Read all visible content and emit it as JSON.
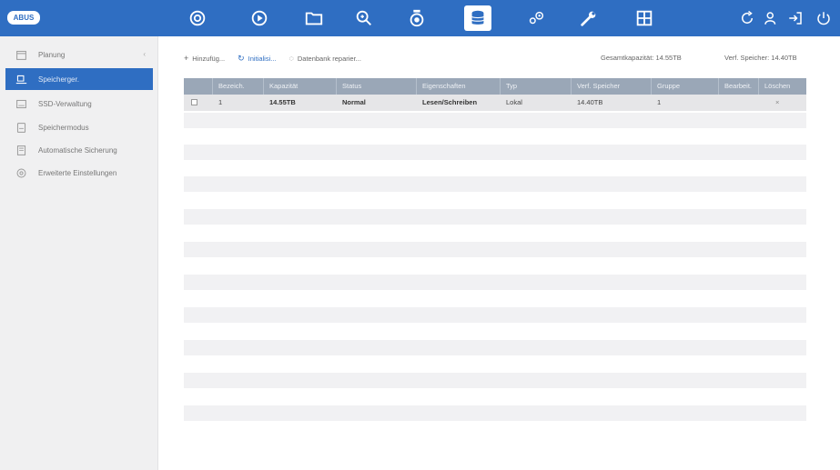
{
  "brand": {
    "label": "ABUS"
  },
  "colors": {
    "topbar": "#2f6ec2",
    "sidebar_active": "#2f6ec2",
    "table_header": "#9aa7b7",
    "row_stripe": "#f1f1f3"
  },
  "topnav": [
    {
      "icon": "camera-eye-icon"
    },
    {
      "icon": "playback-icon"
    },
    {
      "icon": "folder-icon"
    },
    {
      "icon": "search-zoom-icon"
    },
    {
      "icon": "ptz-camera-icon"
    },
    {
      "icon": "storage-database-icon",
      "active": true
    },
    {
      "icon": "settings-gears-icon"
    },
    {
      "icon": "maintenance-wrench-icon"
    },
    {
      "icon": "multiview-grid-icon"
    }
  ],
  "topright": [
    {
      "icon": "refresh-icon"
    },
    {
      "icon": "user-icon"
    },
    {
      "icon": "logout-icon"
    },
    {
      "icon": "power-icon"
    }
  ],
  "sidebar": {
    "items": [
      {
        "label": "Planung",
        "icon": "calendar-icon",
        "chevron": "‹"
      },
      {
        "label": "Speicherger.",
        "icon": "hdd-icon",
        "active": true
      },
      {
        "label": "SSD-Verwaltung",
        "icon": "ssd-icon"
      },
      {
        "label": "Speichermodus",
        "icon": "storage-mode-icon"
      },
      {
        "label": "Automatische Sicherung",
        "icon": "backup-icon"
      },
      {
        "label": "Erweiterte Einstellungen",
        "icon": "advanced-settings-icon"
      }
    ]
  },
  "toolbar": {
    "add": {
      "label": "Hinzufüg...",
      "icon": "+"
    },
    "init": {
      "label": "Initialisi...",
      "icon": "↻"
    },
    "repair": {
      "label": "Datenbank reparier...",
      "icon": "◌"
    }
  },
  "capacity": {
    "total": "Gesamtkapazität: 14.55TB",
    "free": "Verf. Speicher: 14.40TB"
  },
  "table": {
    "columns": [
      "Bezeich.",
      "Kapazität",
      "Status",
      "Eigenschaften",
      "Typ",
      "Verf. Speicher",
      "Gruppe",
      "Bearbeit.",
      "Löschen"
    ],
    "rows": [
      {
        "label": "1",
        "capacity": "14.55TB",
        "status": "Normal",
        "property": "Lesen/Schreiben",
        "type": "Lokal",
        "free": "14.40TB",
        "group": "1",
        "edit": "",
        "delete": "×"
      }
    ]
  }
}
